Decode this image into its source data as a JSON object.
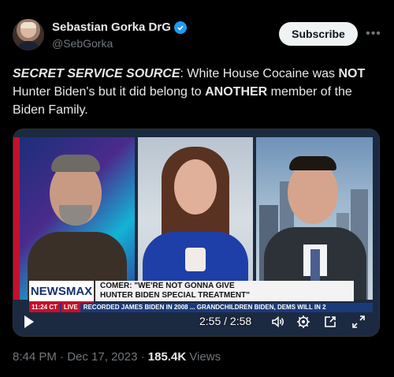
{
  "author": {
    "display_name": "Sebastian Gorka DrG",
    "handle": "@SebGorka",
    "verified": true
  },
  "actions": {
    "subscribe_label": "Subscribe",
    "more_label": "•••"
  },
  "tweet": {
    "text_part1": "SECRET SERVICE SOURCE",
    "text_part2": ": White House Cocaine was ",
    "text_part3": "NOT",
    "text_part4": " Hunter Biden's but it did belong to ",
    "text_part5": "ANOTHER",
    "text_part6": " member of the Biden Family."
  },
  "video": {
    "channel_logo": "NEWSMAX",
    "headline_line1": "COMER: \"WE'RE NOT GONNA GIVE",
    "headline_line2": "HUNTER BIDEN SPECIAL TREATMENT\"",
    "ticker_time": "11:24 CT",
    "ticker_live": "LIVE",
    "ticker_text": "RECORDED JAMES BIDEN IN 2008 ... GRANDCHILDREN BIDEN, DEMS WILL IN 2",
    "timecode": "2:55 / 2:58",
    "icons": [
      "play-icon",
      "volume-icon",
      "settings-gear-icon",
      "picture-in-picture-icon",
      "fullscreen-icon"
    ]
  },
  "meta": {
    "time": "8:44 PM",
    "separator": " · ",
    "date": "Dec 17, 2023",
    "views_count": "185.4K",
    "views_label": " Views"
  },
  "colors": {
    "background": "#000000",
    "verified_blue": "#1d9bf0",
    "muted_text": "#71767b",
    "newsmax_red": "#c3112a"
  }
}
